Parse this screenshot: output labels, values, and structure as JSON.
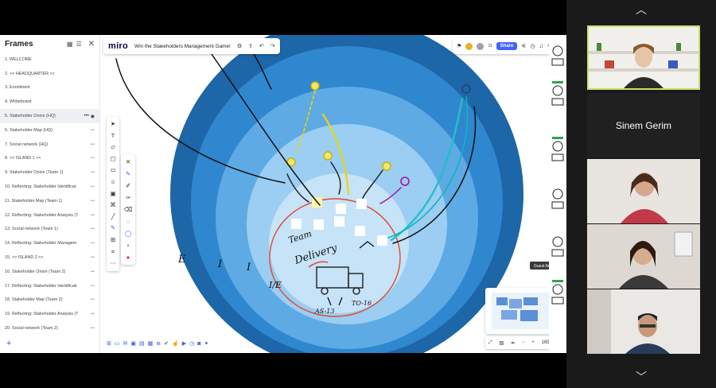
{
  "frames": {
    "title": "Frames",
    "items": [
      {
        "label": "1.  WELCOME"
      },
      {
        "label": "2.  >> HEADQUARTER <<"
      },
      {
        "label": "3.  Enrollment"
      },
      {
        "label": "4.  Whiteboard"
      },
      {
        "label": "5.  Stakeholder Onion (HQ)"
      },
      {
        "label": "6.  Stakeholder Map (HQ)"
      },
      {
        "label": "7.  Social network (HQ)"
      },
      {
        "label": "8.  >> ISLAND 1 <<"
      },
      {
        "label": "9.  Stakeholder Onion (Team 1)"
      },
      {
        "label": "10. Reflecting: Stakeholder Identificat"
      },
      {
        "label": "11. Stakeholder Map (Team 1)"
      },
      {
        "label": "12. Reflecting: Stakeholder Analysis (T"
      },
      {
        "label": "13. Social network (Team 1)"
      },
      {
        "label": "14. Reflecting: Stakeholder Managem"
      },
      {
        "label": "15. >> ISLAND 2 <<"
      },
      {
        "label": "16. Stakeholder Onion (Team 2)"
      },
      {
        "label": "17. Reflecting: Stakeholder Identificati"
      },
      {
        "label": "18. Stakeholder Map (Team 2)"
      },
      {
        "label": "19. Reflecting: Stakeholder Analysis (T"
      },
      {
        "label": "20. Social network (Team 2)"
      }
    ],
    "active_index": 4,
    "add_label": "+"
  },
  "board": {
    "logo": "miro",
    "name": "Win the Stakeholders Management Game!",
    "share_label": "Share",
    "collaborator_count": "11",
    "zoom": "165%",
    "drawing_text": {
      "team": "Team",
      "delivery": "Delivery",
      "ie": "I/E",
      "as": "AS-13",
      "to": "TO-16"
    },
    "guest_tag": "Guest Artist"
  },
  "colors": {
    "ring_outer": "#1d66a8",
    "ring_2": "#2f87cf",
    "ring_3": "#5eaae4",
    "ring_4": "#9ccdf2",
    "center": "#c6e3f8",
    "accent": "#4262ff",
    "active_tile_border": "#c9e264"
  },
  "participants": [
    {
      "name": "Sinem Gerim"
    }
  ],
  "icons": {
    "up": "chevron-up-icon",
    "down": "chevron-down-icon"
  }
}
